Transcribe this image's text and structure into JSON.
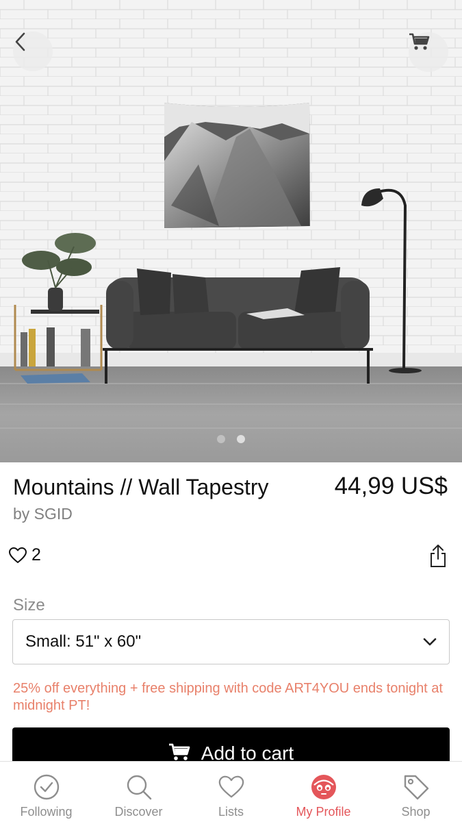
{
  "product": {
    "title": "Mountains // Wall Tapestry",
    "price": "44,99 US$",
    "artist": "by SGID",
    "likes": "2"
  },
  "gallery": {
    "image_count": 2,
    "active_index": 1,
    "icons": {
      "back": "chevron-left-icon",
      "cart": "cart-icon"
    }
  },
  "size": {
    "label": "Size",
    "selected": "Small: 51\" x 60\""
  },
  "promo": "25% off everything + free shipping with code ART4YOU ends tonight at midnight PT!",
  "add_to_cart": "Add to cart",
  "tabs": [
    {
      "label": "Following",
      "icon": "check-circle-icon"
    },
    {
      "label": "Discover",
      "icon": "search-icon"
    },
    {
      "label": "Lists",
      "icon": "heart-icon"
    },
    {
      "label": "My Profile",
      "icon": "profile-face-icon",
      "active": true
    },
    {
      "label": "Shop",
      "icon": "tag-icon"
    }
  ],
  "colors": {
    "accent": "#e4565a",
    "promo": "#e8806a",
    "button": "#000000"
  }
}
